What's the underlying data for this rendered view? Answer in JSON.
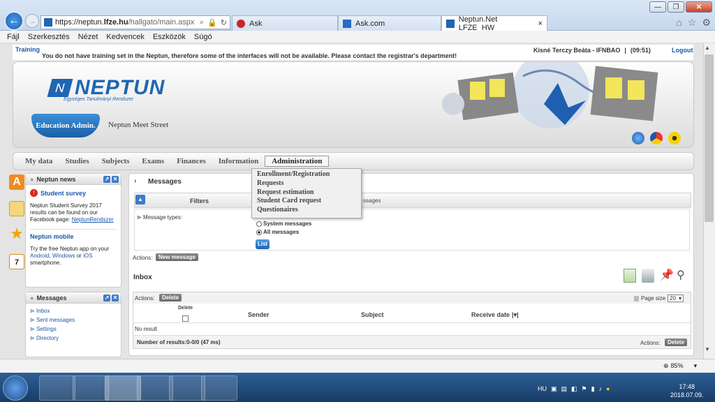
{
  "browser": {
    "url_prefix": "https://neptun.",
    "url_domain": "lfze.hu",
    "url_path": "/hallgato/main.aspx",
    "tabs": [
      {
        "label": "Ask"
      },
      {
        "label": "Ask.com"
      },
      {
        "label": "Neptun.Net LFZE_HW"
      }
    ],
    "tab_close": "×"
  },
  "menu": [
    "Fájl",
    "Szerkesztés",
    "Nézet",
    "Kedvencek",
    "Eszközök",
    "Súgó"
  ],
  "top": {
    "training": "Training",
    "warning": "You do not have training set in the Neptun, therefore some of the interfaces will not be available. Please contact the registrar's department!",
    "user": "Kisné Terczy Beáta - IFNBAO",
    "separator": "|",
    "timer": "(09:51)",
    "logout": "Logout"
  },
  "header": {
    "logo": "NEPTUN",
    "logo_sub": "Egységes Tanulmányi Rendszer",
    "role": "Education Admin.",
    "meet_street": "Neptun Meet Street"
  },
  "nav": [
    "My data",
    "Studies",
    "Subjects",
    "Exams",
    "Finances",
    "Information",
    "Administration"
  ],
  "dropdown": [
    "Enrollment/Registration",
    "Requests",
    "Request estimation",
    "Student Card request",
    "Questionaires"
  ],
  "news": {
    "title": "Neptun news",
    "survey_title": "Student survey",
    "survey_text1": "Neptun Student Survey 2017",
    "survey_text2": "results can be found on our",
    "survey_text3": "Facebook page:",
    "survey_link": "NeptunRendszer",
    "mobile_title": "Neptun mobile",
    "mobile_text1": "Try the free Neptun app on your",
    "mobile_android": "Android",
    "mobile_comma": ",",
    "mobile_windows": "Windows",
    "mobile_or": "or",
    "mobile_ios": "iOS",
    "mobile_text2": "smartphone."
  },
  "messages_panel": {
    "title": "Messages",
    "items": [
      "Inbox",
      "Sent messages",
      "Settings",
      "Directory"
    ]
  },
  "main": {
    "title": "Messages",
    "filters": "Filters",
    "hidden_tab": "ssages",
    "message_types": "Message types:",
    "radio_system": "System messages",
    "radio_all": "All messages",
    "list_button": "List",
    "actions": "Actions:",
    "new_message": "New message",
    "inbox": "Inbox",
    "delete": "Delete",
    "page_size_label": "Page size",
    "page_size_value": "20",
    "col_delete": "Delete",
    "col_sender": "Sender",
    "col_subject": "Subject",
    "col_date": "Receive date",
    "no_result": "No result",
    "num_results": "Number of results:0-0/0 (47 ms)"
  },
  "status": {
    "zoom": "85%"
  },
  "taskbar": {
    "lang": "HU",
    "time": "17:48",
    "date": "2018.07.09."
  },
  "colors": {
    "accent": "#1f66b3",
    "link": "#1a58a8"
  }
}
